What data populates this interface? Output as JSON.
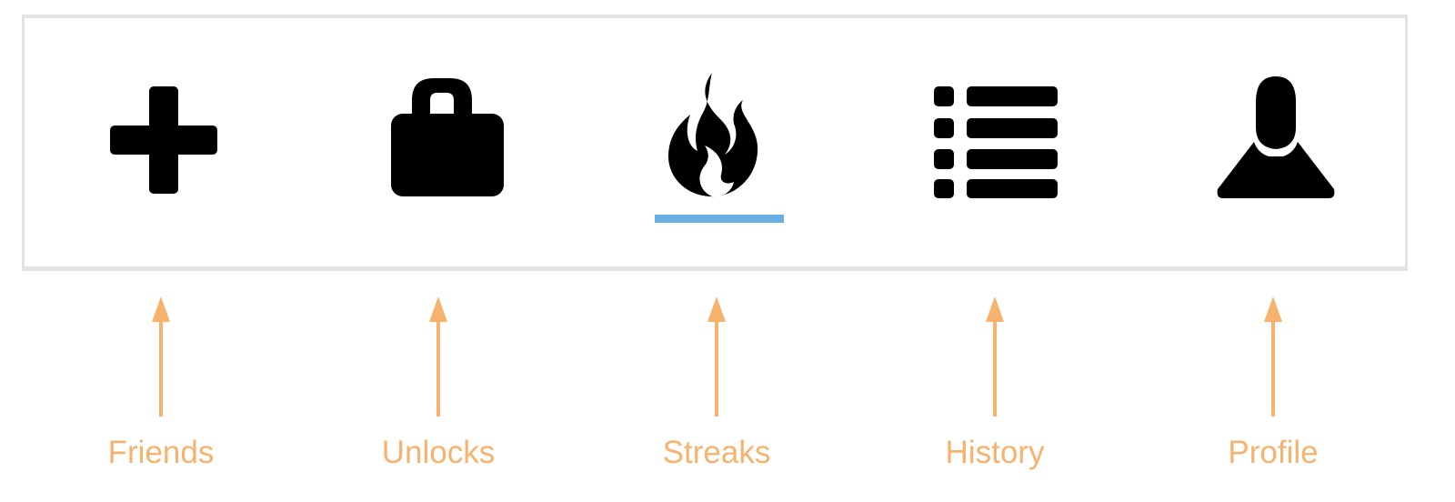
{
  "theme": {
    "icon_color": "#000000",
    "active_indicator_color": "#6aaee6",
    "annotation_color": "#f7b26e",
    "bar_border_color": "#e3e3e3"
  },
  "tabs": [
    {
      "id": "friends",
      "icon": "plus-icon",
      "label": "Friends",
      "active": false
    },
    {
      "id": "unlocks",
      "icon": "lock-icon",
      "label": "Unlocks",
      "active": false
    },
    {
      "id": "streaks",
      "icon": "flame-icon",
      "label": "Streaks",
      "active": true
    },
    {
      "id": "history",
      "icon": "list-icon",
      "label": "History",
      "active": false
    },
    {
      "id": "profile",
      "icon": "person-icon",
      "label": "Profile",
      "active": false
    }
  ]
}
